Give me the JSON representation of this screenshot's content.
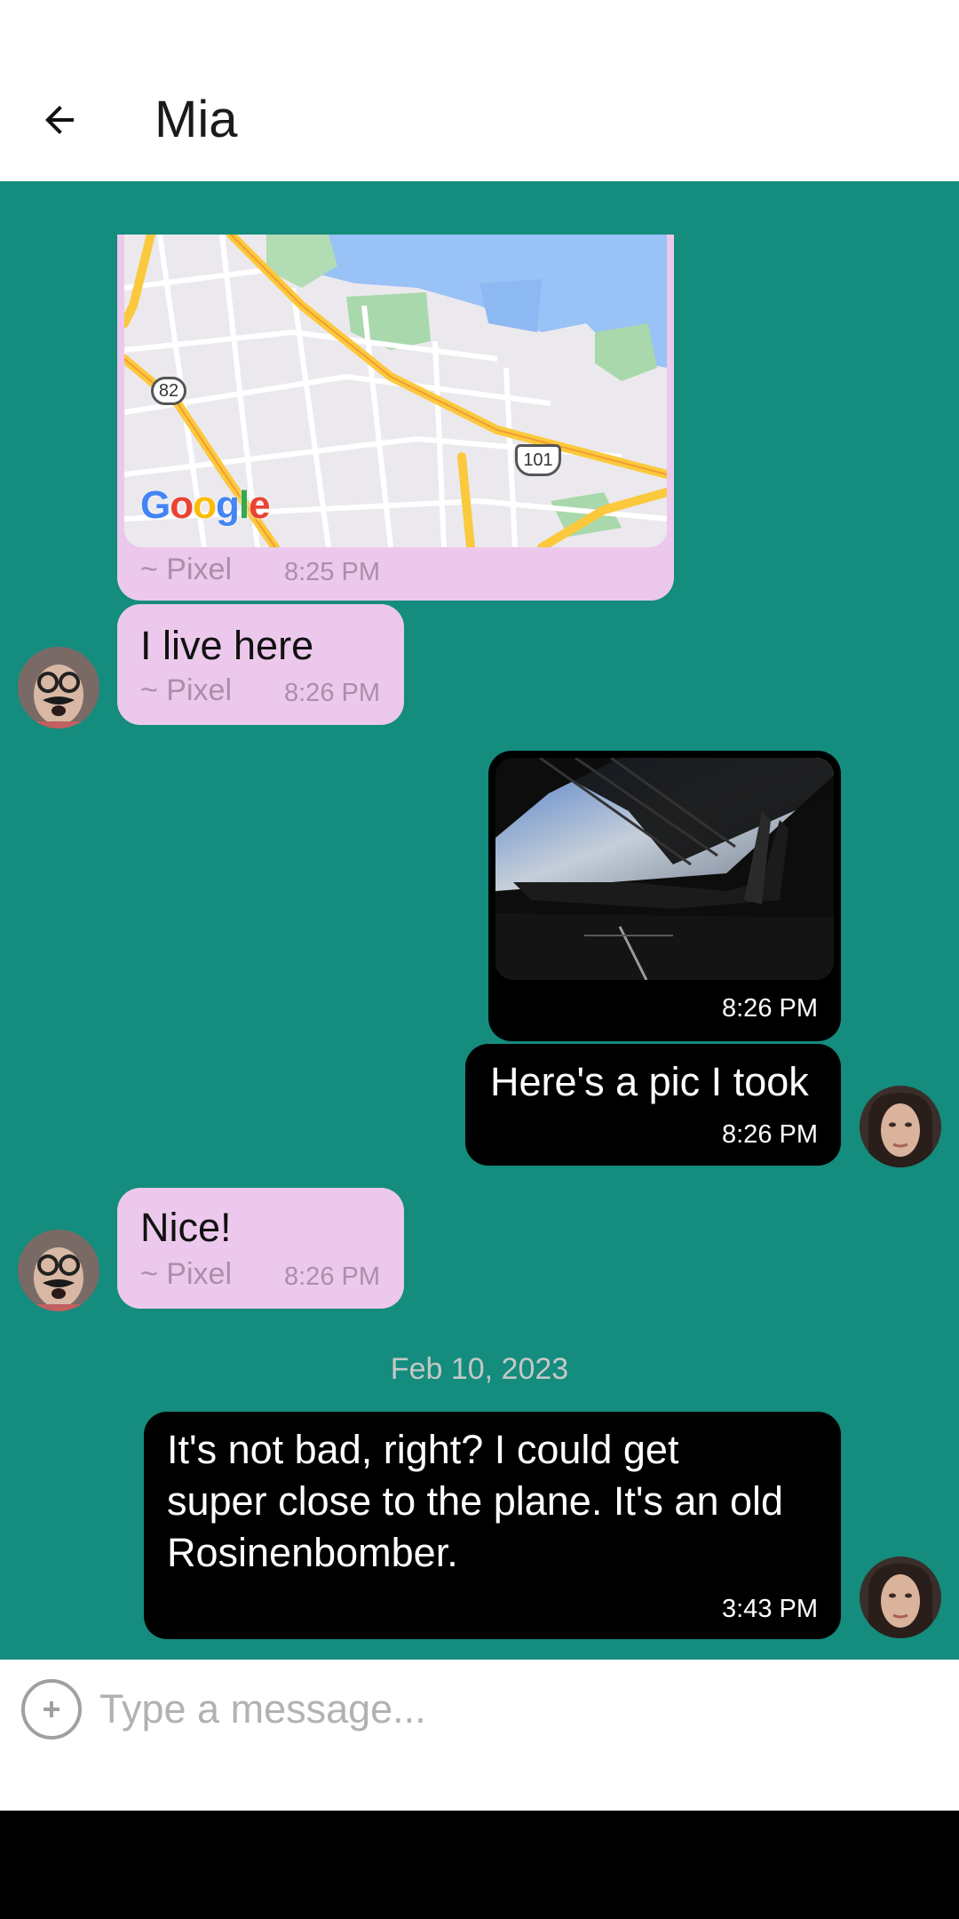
{
  "header": {
    "title": "Mia",
    "back_icon": "arrow-left-icon"
  },
  "messages": [
    {
      "direction": "incoming",
      "type": "map",
      "sender": "~ Pixel",
      "time": "8:25 PM",
      "map": {
        "logo": "Google",
        "route_shield_1": "82",
        "route_shield_2": "101"
      }
    },
    {
      "direction": "incoming",
      "type": "text",
      "text": "I live here",
      "sender": "~ Pixel",
      "time": "8:26 PM"
    },
    {
      "direction": "outgoing",
      "type": "image",
      "time": "8:26 PM"
    },
    {
      "direction": "outgoing",
      "type": "text",
      "text": "Here's a pic I took",
      "time": "8:26 PM"
    },
    {
      "direction": "incoming",
      "type": "text",
      "text": "Nice!",
      "sender": "~ Pixel",
      "time": "8:26 PM"
    },
    {
      "direction": "outgoing",
      "type": "text",
      "lines": [
        "It's not bad, right? I could get",
        "super close to the plane. It's an old",
        "Rosinenbomber."
      ],
      "time": "3:43 PM"
    }
  ],
  "date_separator": "Feb 10, 2023",
  "composer": {
    "placeholder": "Type a message...",
    "attach_icon": "plus-circle-icon"
  },
  "colors": {
    "chat_background": "#148c7e",
    "incoming_bubble": "#ecc8ec",
    "outgoing_bubble": "#000000"
  }
}
